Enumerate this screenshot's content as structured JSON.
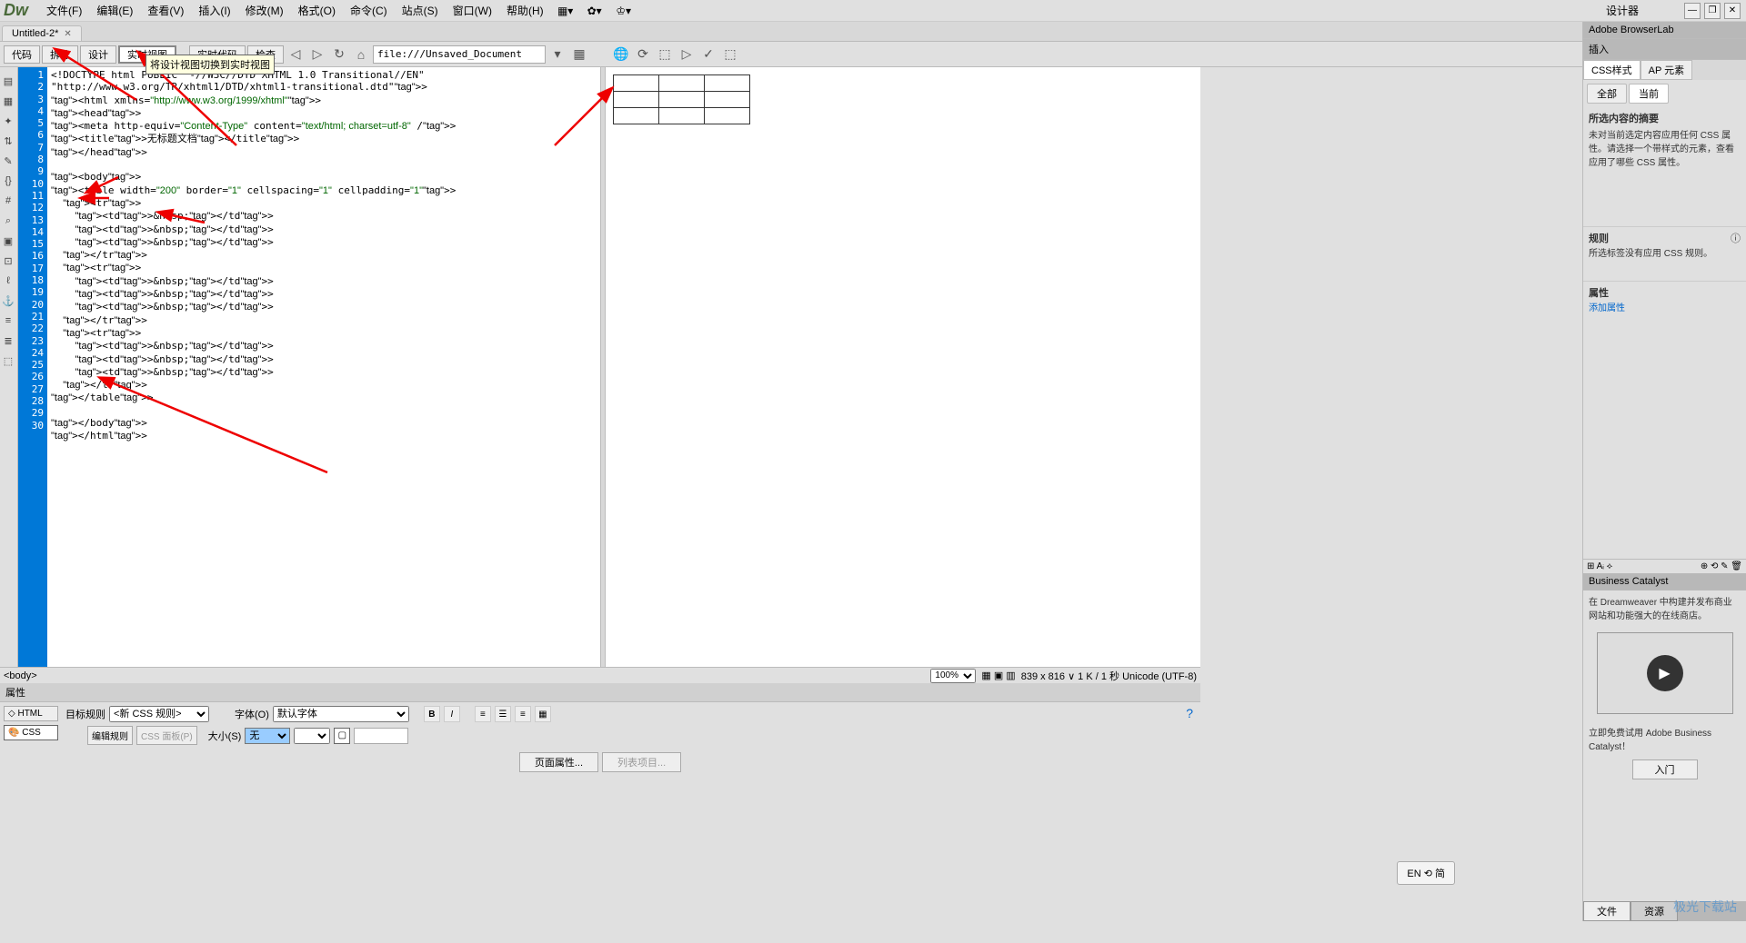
{
  "app": {
    "logo": "Dw"
  },
  "menu": {
    "file": "文件(F)",
    "edit": "编辑(E)",
    "view": "查看(V)",
    "insert": "插入(I)",
    "modify": "修改(M)",
    "format": "格式(O)",
    "commands": "命令(C)",
    "site": "站点(S)",
    "window": "窗口(W)",
    "help": "帮助(H)",
    "designer": "设计器"
  },
  "tab": {
    "name": "Untitled-2*"
  },
  "views": {
    "code": "代码",
    "split": "拆分",
    "design": "设计",
    "live": "实时视图",
    "live_code": "实时代码",
    "inspect": "检查"
  },
  "tooltip": "将设计视图切换到实时视图",
  "url": "file:///Unsaved_Document",
  "code_lines": [
    "<!DOCTYPE html PUBLIC \"-//W3C//DTD XHTML 1.0 Transitional//EN\"",
    "\"http://www.w3.org/TR/xhtml1/DTD/xhtml1-transitional.dtd\">",
    "<html xmlns=\"http://www.w3.org/1999/xhtml\">",
    "<head>",
    "<meta http-equiv=\"Content-Type\" content=\"text/html; charset=utf-8\" />",
    "<title>无标题文档</title>",
    "</head>",
    "",
    "<body>",
    "<table width=\"200\" border=\"1\" cellspacing=\"1\" cellpadding=\"1\">",
    "  <tr>",
    "    <td>&nbsp;</td>",
    "    <td>&nbsp;</td>",
    "    <td>&nbsp;</td>",
    "  </tr>",
    "  <tr>",
    "    <td>&nbsp;</td>",
    "    <td>&nbsp;</td>",
    "    <td>&nbsp;</td>",
    "  </tr>",
    "  <tr>",
    "    <td>&nbsp;</td>",
    "    <td>&nbsp;</td>",
    "    <td>&nbsp;</td>",
    "  </tr>",
    "</table>",
    "",
    "</body>",
    "</html>",
    ""
  ],
  "status": {
    "tag": "<body>",
    "zoom": "100%",
    "dims": "839 x 816 ∨ 1 K / 1 秒 Unicode (UTF-8)"
  },
  "properties": {
    "title": "属性",
    "html_btn": "HTML",
    "css_btn": "CSS",
    "target_rule": "目标规则",
    "new_rule": "<新 CSS 规则>",
    "edit_rule": "编辑规则",
    "css_panel": "CSS 面板(P)",
    "font": "字体(O)",
    "default_font": "默认字体",
    "size": "大小(S)",
    "size_val": "无",
    "page_props": "页面属性...",
    "list_item": "列表项目..."
  },
  "right": {
    "browserlab": "Adobe BrowserLab",
    "insert": "插入",
    "css_styles": "CSS样式",
    "ap_elem": "AP 元素",
    "all": "全部",
    "current": "当前",
    "summary_title": "所选内容的摘要",
    "summary_text": "未对当前选定内容应用任何 CSS 属性。请选择一个带样式的元素，查看应用了哪些 CSS 属性。",
    "rules_title": "规则",
    "rules_text": "所选标签没有应用 CSS 规则。",
    "props_title": "属性",
    "add_prop": "添加属性",
    "bc_title": "Business Catalyst",
    "bc_text": "在 Dreamweaver 中构建并发布商业网站和功能强大的在线商店。",
    "bc_link": "立即免费试用 Adobe Business Catalyst！",
    "bc_btn": "入门",
    "files": "文件",
    "resources": "资源"
  },
  "ime": "EN ⟲ 简",
  "watermark": "极光下载站"
}
